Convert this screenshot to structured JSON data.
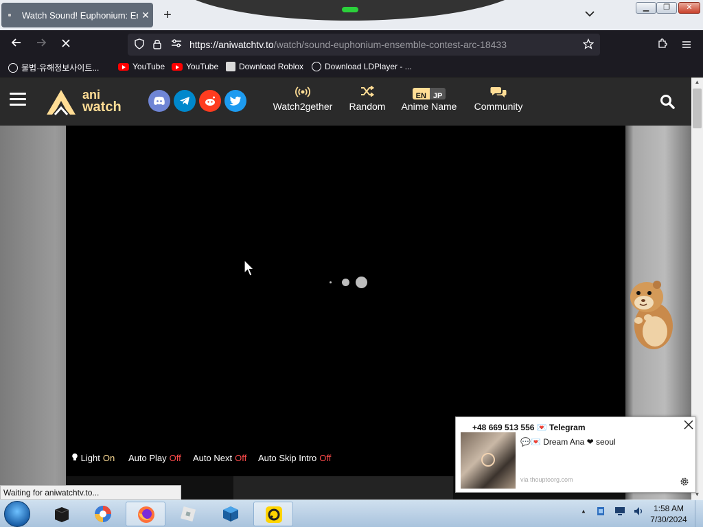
{
  "browser": {
    "tab_title": "Watch Sound! Euphonium: Ensemble Contest Arc",
    "tab_close": "✕",
    "new_tab": "+",
    "list_tabs": "⌄",
    "window": {
      "minimize": "▁",
      "maximize": "❐",
      "close": "✕"
    },
    "url_host": "https://aniwatchtv.to",
    "url_path": "/watch/sound-euphonium-ensemble-contest-arc-18433",
    "bookmarks": [
      {
        "label": "불법·유해정보사이트...",
        "icon": "globe-icon"
      },
      {
        "label": "YouTube",
        "icon": "youtube-icon"
      },
      {
        "label": "YouTube",
        "icon": "youtube-icon"
      },
      {
        "label": "Download Roblox",
        "icon": "document-icon"
      },
      {
        "label": "Download LDPlayer - ...",
        "icon": "globe-icon"
      }
    ],
    "status_text": "Waiting for aniwatchtv.to..."
  },
  "site": {
    "logo_top": "ani",
    "logo_bottom": "watch",
    "menu": [
      {
        "label": "Watch2gether",
        "icon": "broadcast-icon"
      },
      {
        "label": "Random",
        "icon": "shuffle-icon"
      },
      {
        "label": "Anime Name",
        "icon": "language-toggle"
      },
      {
        "label": "Community",
        "icon": "chat-bubbles-icon"
      }
    ],
    "lang_en": "EN",
    "lang_jp": "JP",
    "social": [
      {
        "name": "discord",
        "color": "#6f85d5"
      },
      {
        "name": "telegram",
        "color": "#0088cc"
      },
      {
        "name": "reddit",
        "color": "#ff3c1f"
      },
      {
        "name": "twitter",
        "color": "#1d9bf0"
      }
    ],
    "accent": "#ffdd95"
  },
  "player_controls": {
    "light_label": "Light",
    "light_value": "On",
    "autoplay_label": "Auto Play",
    "autoplay_value": "Off",
    "autonext_label": "Auto Next",
    "autonext_value": "Off",
    "autoskip_label": "Auto Skip Intro",
    "autoskip_value": "Off"
  },
  "notification": {
    "title": "+48 669 513 556 💌 Telegram",
    "body": "💬💌 Dream Ana ❤ seoul",
    "source": "via thouptoorg.com"
  },
  "taskbar": {
    "clock_time": "1:58 AM",
    "clock_date": "7/30/2024",
    "tray_arrow": "▲"
  }
}
